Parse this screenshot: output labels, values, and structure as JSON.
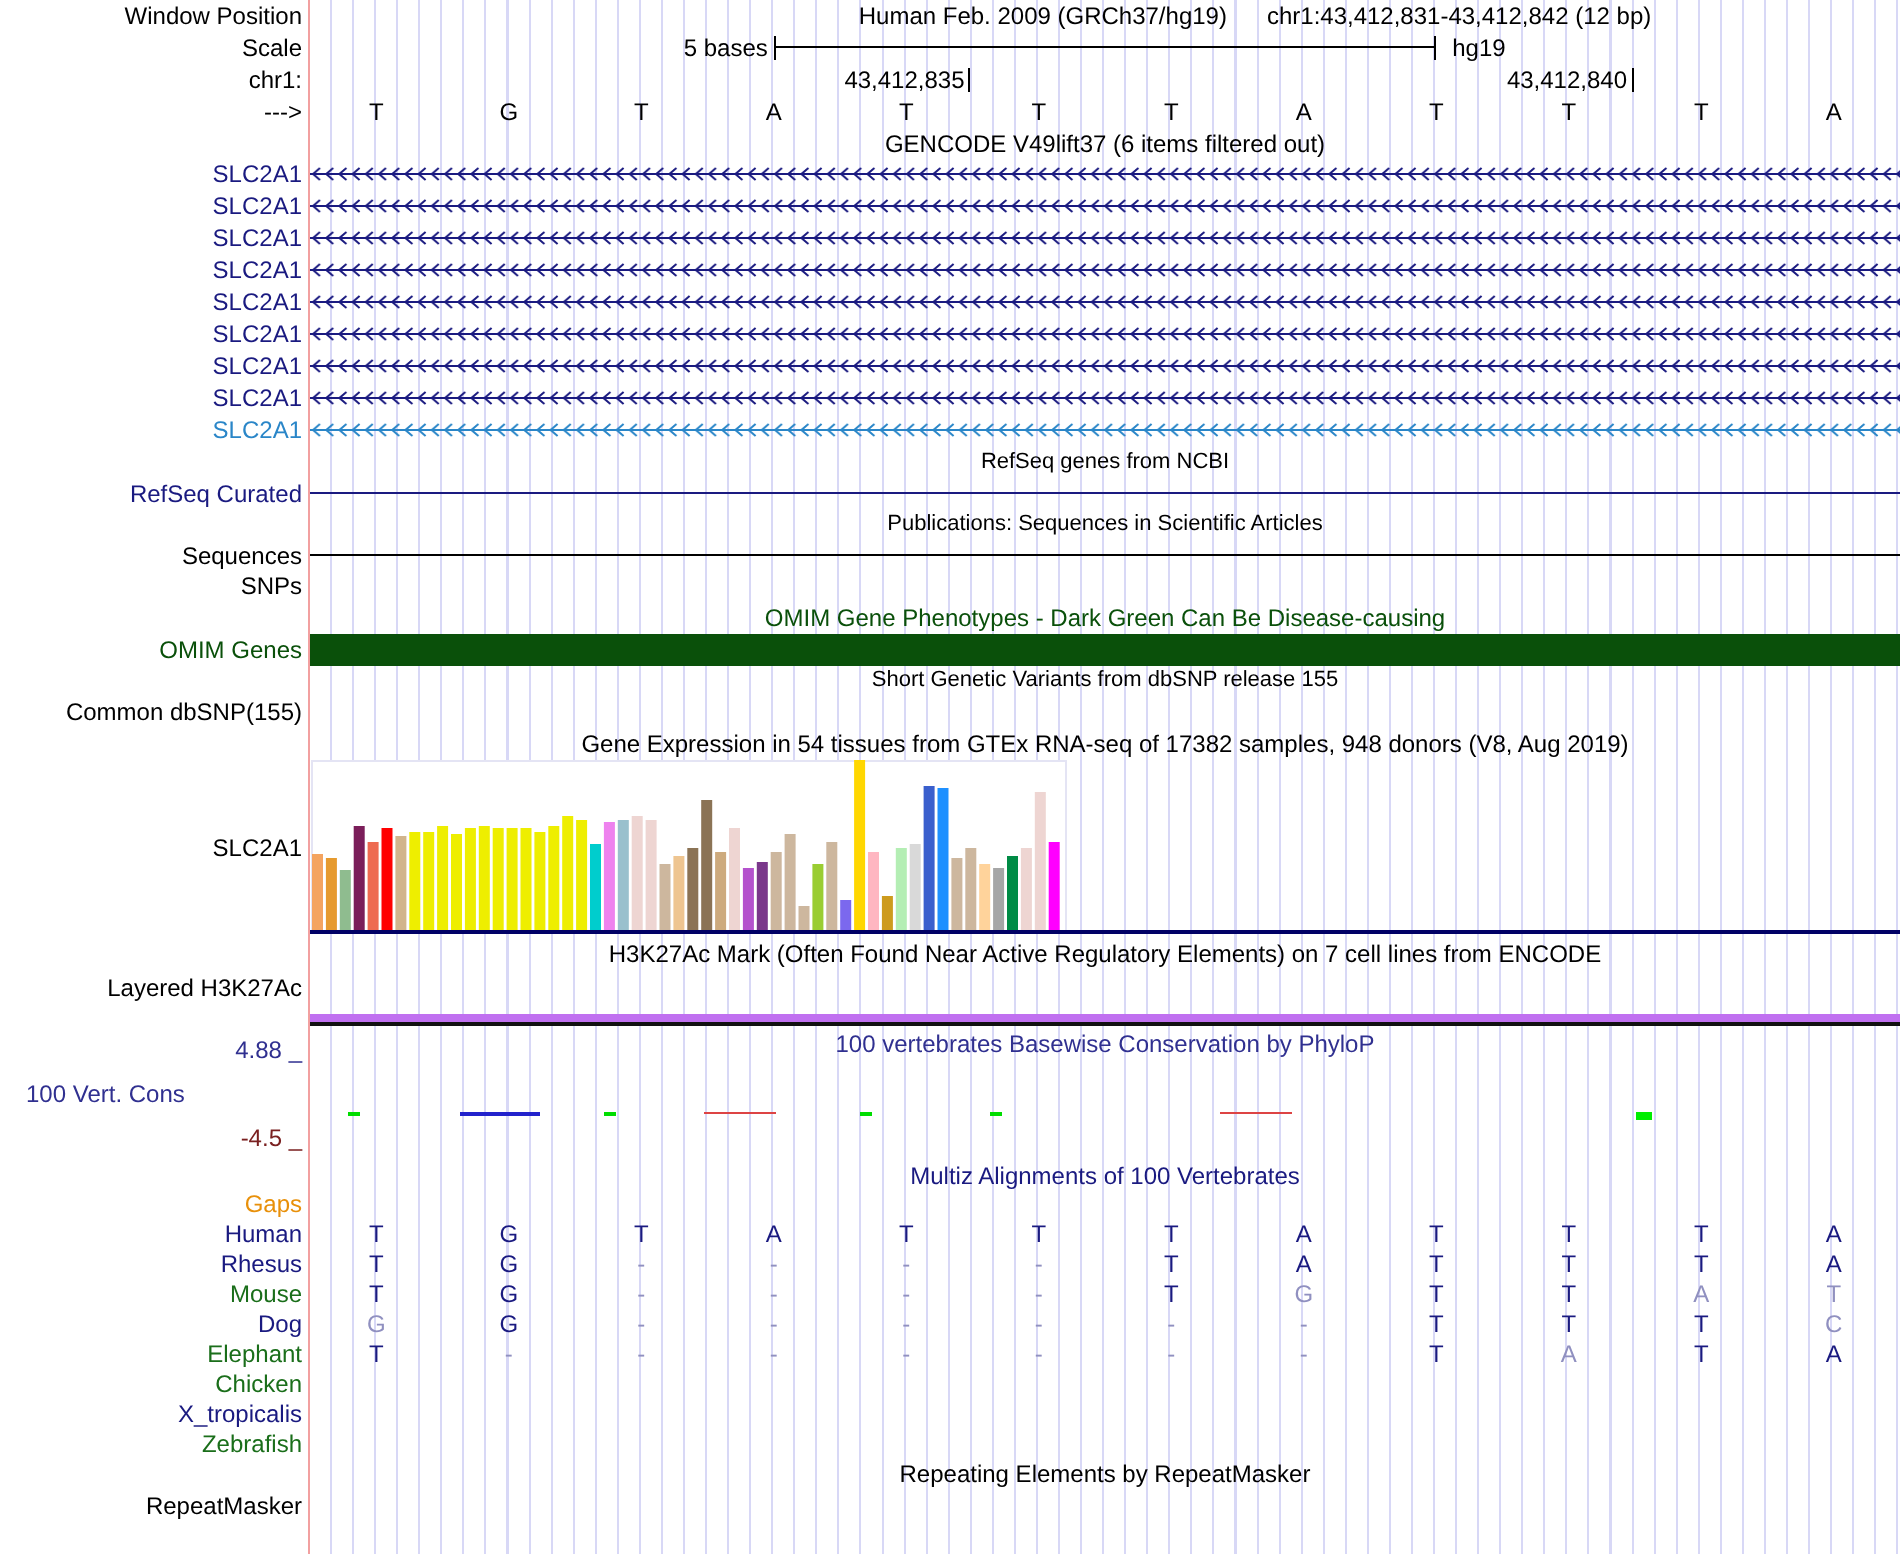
{
  "window_position": {
    "label": "Window Position",
    "assembly": "Human Feb. 2009 (GRCh37/hg19)",
    "range": "chr1:43,412,831-43,412,842 (12 bp)"
  },
  "scale": {
    "label": "Scale",
    "length": "5 bases",
    "assembly": "hg19"
  },
  "chromosome": {
    "label": "chr1:"
  },
  "strand": {
    "label": "--->"
  },
  "bases": [
    {
      "base": "T"
    },
    {
      "base": "G"
    },
    {
      "base": "T"
    },
    {
      "base": "A"
    },
    {
      "base": "T",
      "tick": "43,412,835"
    },
    {
      "base": "T"
    },
    {
      "base": "T"
    },
    {
      "base": "A"
    },
    {
      "base": "T"
    },
    {
      "base": "T",
      "tick": "43,412,840"
    },
    {
      "base": "T"
    },
    {
      "base": "A"
    }
  ],
  "gencode": {
    "title": "GENCODE V49lift37 (6 items filtered out)",
    "genes": [
      {
        "name": "SLC2A1",
        "color": "#1a1a80"
      },
      {
        "name": "SLC2A1",
        "color": "#1a1a80"
      },
      {
        "name": "SLC2A1",
        "color": "#1a1a80"
      },
      {
        "name": "SLC2A1",
        "color": "#1a1a80"
      },
      {
        "name": "SLC2A1",
        "color": "#1a1a80"
      },
      {
        "name": "SLC2A1",
        "color": "#1a1a80"
      },
      {
        "name": "SLC2A1",
        "color": "#1a1a80"
      },
      {
        "name": "SLC2A1",
        "color": "#1a1a80"
      },
      {
        "name": "SLC2A1",
        "color": "#2a86c8"
      }
    ]
  },
  "refseq": {
    "title": "RefSeq genes from NCBI",
    "label": "RefSeq Curated"
  },
  "sequences": {
    "title": "Publications: Sequences in Scientific Articles",
    "label": "Sequences"
  },
  "snps": {
    "label": "SNPs"
  },
  "omim": {
    "title": "OMIM Gene Phenotypes - Dark Green Can Be Disease-causing",
    "label": "OMIM Genes"
  },
  "dbsnp": {
    "title": "Short Genetic Variants from dbSNP release 155",
    "label": "Common dbSNP(155)"
  },
  "gtex": {
    "title": "Gene Expression in 54 tissues from GTEx RNA-seq of 17382 samples, 948 donors (V8, Aug 2019)",
    "label": "SLC2A1"
  },
  "h3k27ac": {
    "title": "H3K27Ac Mark (Often Found Near Active Regulatory Elements) on 7 cell lines from ENCODE",
    "label": "Layered H3K27Ac"
  },
  "conservation": {
    "title": "100 vertebrates Basewise Conservation by PhyloP",
    "label": "100 Vert. Cons",
    "max": "4.88 _",
    "min": "-4.5 _"
  },
  "multiz": {
    "title": "Multiz Alignments of 100 Vertebrates",
    "gaps_label": "Gaps",
    "species": [
      {
        "name": "Human",
        "color": "#1a1a80",
        "bases": [
          {
            "base": "T",
            "faded": false
          },
          {
            "base": "G",
            "faded": false
          },
          {
            "base": "T",
            "faded": false
          },
          {
            "base": "A",
            "faded": false
          },
          {
            "base": "T",
            "faded": false
          },
          {
            "base": "T",
            "faded": false
          },
          {
            "base": "T",
            "faded": false
          },
          {
            "base": "A",
            "faded": false
          },
          {
            "base": "T",
            "faded": false
          },
          {
            "base": "T",
            "faded": false
          },
          {
            "base": "T",
            "faded": false
          },
          {
            "base": "A",
            "faded": false
          }
        ]
      },
      {
        "name": "Rhesus",
        "color": "#1a1a80",
        "bases": [
          {
            "base": "T",
            "faded": false
          },
          {
            "base": "G",
            "faded": false
          },
          {
            "base": "-",
            "faded": true
          },
          {
            "base": "-",
            "faded": true
          },
          {
            "base": "-",
            "faded": true
          },
          {
            "base": "-",
            "faded": true
          },
          {
            "base": "T",
            "faded": false
          },
          {
            "base": "A",
            "faded": false
          },
          {
            "base": "T",
            "faded": false
          },
          {
            "base": "T",
            "faded": false
          },
          {
            "base": "T",
            "faded": false
          },
          {
            "base": "A",
            "faded": false
          }
        ]
      },
      {
        "name": "Mouse",
        "color": "#1a6e1a",
        "bases": [
          {
            "base": "T",
            "faded": false
          },
          {
            "base": "G",
            "faded": false
          },
          {
            "base": "-",
            "faded": true
          },
          {
            "base": "-",
            "faded": true
          },
          {
            "base": "-",
            "faded": true
          },
          {
            "base": "-",
            "faded": true
          },
          {
            "base": "T",
            "faded": false
          },
          {
            "base": "G",
            "faded": true
          },
          {
            "base": "T",
            "faded": false
          },
          {
            "base": "T",
            "faded": false
          },
          {
            "base": "A",
            "faded": true
          },
          {
            "base": "T",
            "faded": true
          }
        ]
      },
      {
        "name": "Dog",
        "color": "#1a1a80",
        "bases": [
          {
            "base": "G",
            "faded": true
          },
          {
            "base": "G",
            "faded": false
          },
          {
            "base": "-",
            "faded": true
          },
          {
            "base": "-",
            "faded": true
          },
          {
            "base": "-",
            "faded": true
          },
          {
            "base": "-",
            "faded": true
          },
          {
            "base": "-",
            "faded": true
          },
          {
            "base": "-",
            "faded": true
          },
          {
            "base": "T",
            "faded": false
          },
          {
            "base": "T",
            "faded": false
          },
          {
            "base": "T",
            "faded": false
          },
          {
            "base": "C",
            "faded": true
          }
        ]
      },
      {
        "name": "Elephant",
        "color": "#1a6e1a",
        "bases": [
          {
            "base": "T",
            "faded": false
          },
          {
            "base": "-",
            "faded": true
          },
          {
            "base": "-",
            "faded": true
          },
          {
            "base": "-",
            "faded": true
          },
          {
            "base": "-",
            "faded": true
          },
          {
            "base": "-",
            "faded": true
          },
          {
            "base": "-",
            "faded": true
          },
          {
            "base": "-",
            "faded": true
          },
          {
            "base": "T",
            "faded": false
          },
          {
            "base": "A",
            "faded": true
          },
          {
            "base": "T",
            "faded": false
          },
          {
            "base": "A",
            "faded": false
          }
        ]
      },
      {
        "name": "Chicken",
        "color": "#1a6e1a"
      },
      {
        "name": "X_tropicalis",
        "color": "#1a1a80"
      },
      {
        "name": "Zebrafish",
        "color": "#1a6e1a"
      }
    ]
  },
  "repeatmasker": {
    "title": "Repeating Elements by RepeatMasker",
    "label": "RepeatMasker"
  }
}
